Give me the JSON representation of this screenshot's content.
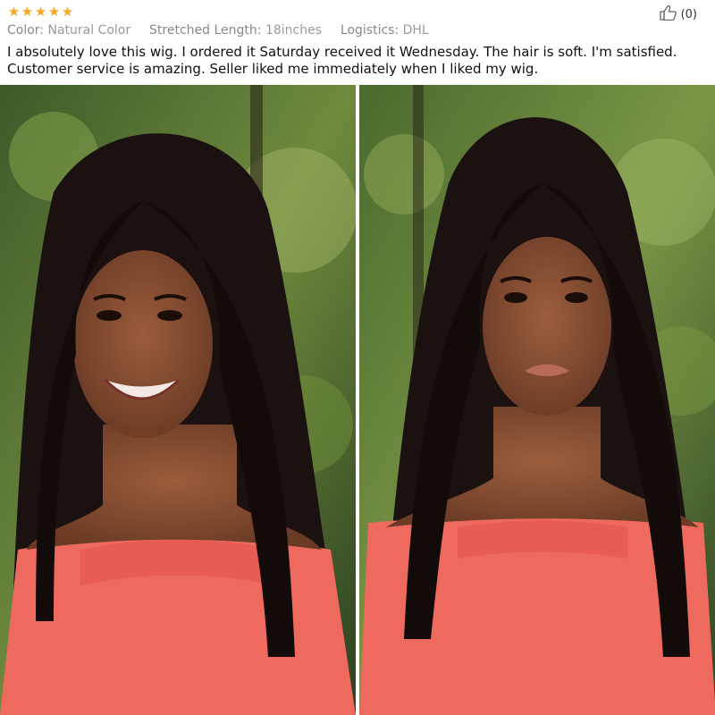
{
  "review": {
    "rating": 5,
    "helpful_count": "(0)",
    "meta": [
      {
        "key": "Color:",
        "value": "Natural Color"
      },
      {
        "key": "Stretched Length:",
        "value": "18inches"
      },
      {
        "key": "Logistics:",
        "value": "DHL"
      }
    ],
    "text": "I absolutely love this wig. I ordered it Saturday received it Wednesday. The hair is soft. I'm satisfied. Customer service is amazing. Seller liked me immediately when I liked my wig."
  },
  "icons": {
    "star": "star-icon",
    "thumb": "thumbs-up-icon"
  },
  "colors": {
    "star": "#f5a623",
    "meta_text": "#999999",
    "top_fabric": "#ee6a5f"
  }
}
